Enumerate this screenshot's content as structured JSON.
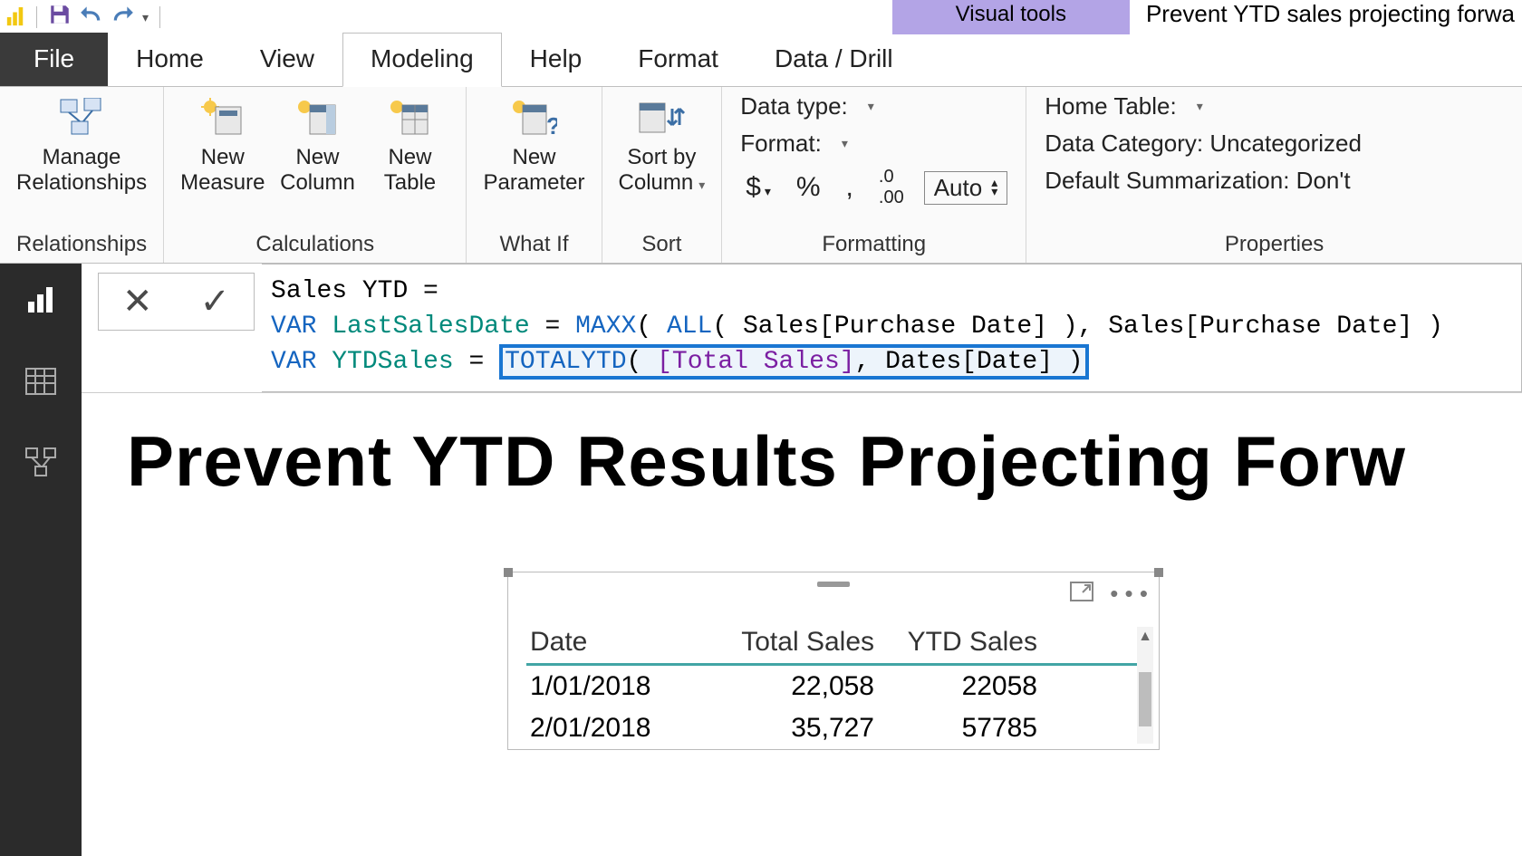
{
  "titlebar": {
    "visual_tools": "Visual tools",
    "doc_title": "Prevent YTD sales projecting forwa"
  },
  "tabs": {
    "file": "File",
    "home": "Home",
    "view": "View",
    "modeling": "Modeling",
    "help": "Help",
    "format": "Format",
    "data_drill": "Data / Drill"
  },
  "ribbon": {
    "relationships": {
      "manage": "Manage\nRelationships",
      "group": "Relationships"
    },
    "calc": {
      "measure": "New\nMeasure",
      "column": "New\nColumn",
      "table": "New\nTable",
      "group": "Calculations"
    },
    "whatif": {
      "param": "New\nParameter",
      "group": "What If"
    },
    "sort": {
      "sort": "Sort by\nColumn",
      "group": "Sort"
    },
    "formatting": {
      "datatype": "Data type:",
      "format": "Format:",
      "auto": "Auto",
      "group": "Formatting"
    },
    "props": {
      "home_table": "Home Table:",
      "data_cat": "Data Category: Uncategorized",
      "summ": "Default Summarization: Don't",
      "group": "Properties"
    }
  },
  "formula": {
    "line1_a": "Sales YTD = ",
    "line2_var": "VAR ",
    "line2_name": "LastSalesDate",
    "line2_eq": " = ",
    "line2_fn1": "MAXX",
    "line2_p1": "( ",
    "line2_fn2": "ALL",
    "line2_p2": "( Sales[Purchase Date] ), Sales[Purchase Date] )",
    "line3_var": "VAR ",
    "line3_name": "YTDSales",
    "line3_eq": " = ",
    "line3_fn": "TOTALYTD",
    "line3_p1": "( ",
    "line3_meas": "[Total Sales]",
    "line3_p2": ", Dates[Date] )"
  },
  "report_title": "Prevent YTD Results Projecting Forw",
  "table": {
    "headers": {
      "c1": "Date",
      "c2": "Total Sales",
      "c3": "YTD Sales"
    },
    "rows": [
      {
        "c1": "1/01/2018",
        "c2": "22,058",
        "c3": "22058"
      },
      {
        "c1": "2/01/2018",
        "c2": "35,727",
        "c3": "57785"
      }
    ]
  }
}
